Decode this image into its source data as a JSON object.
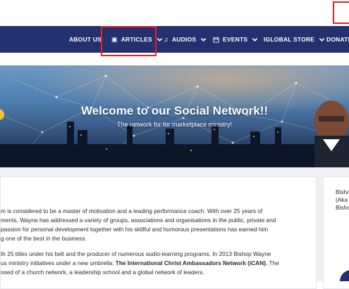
{
  "nav": {
    "items": [
      {
        "label": "ABOUT US",
        "icon": "",
        "has_dropdown": false
      },
      {
        "label": "ARTICLES",
        "icon": "article-icon",
        "has_dropdown": true
      },
      {
        "label": "AUDIOS",
        "icon": "music-note-icon",
        "has_dropdown": true
      },
      {
        "label": "EVENTS",
        "icon": "calendar-icon",
        "has_dropdown": true
      },
      {
        "label": "IGLOBAL STORE",
        "icon": "",
        "has_dropdown": true
      },
      {
        "label": "DONATE",
        "icon": "",
        "has_dropdown": false
      }
    ]
  },
  "hero": {
    "title": "Welcome to our Social Network!!",
    "subtitle": "The network for for marketplace ministry!"
  },
  "article": {
    "lines": [
      "m is considered to be a master of motivation and a leading performance coach. With over 25 years of",
      "ments, Wayne has addressed a variety of groups, associations and organisations in the public, private and",
      " passion for personal development together with his skillful and humorous presentations has earned him",
      "g one of the best in the business.",
      "th 25 titles under his belt and the producer of numerous audio-learning programs. In 2013 Bishop Wayne",
      "us ministry initiatives under a new umbrella:  ",
      "osed of a church network, a leadership school and a global network of leaders."
    ],
    "bold_segment": "The International Christ Ambassadors Network (iCAN).",
    "after_bold": " The"
  },
  "sidebar": {
    "lines": [
      "Bisho",
      "(Aka",
      "Bisho"
    ]
  },
  "colors": {
    "nav_bg": "#25306f",
    "highlight": "#e02424"
  }
}
